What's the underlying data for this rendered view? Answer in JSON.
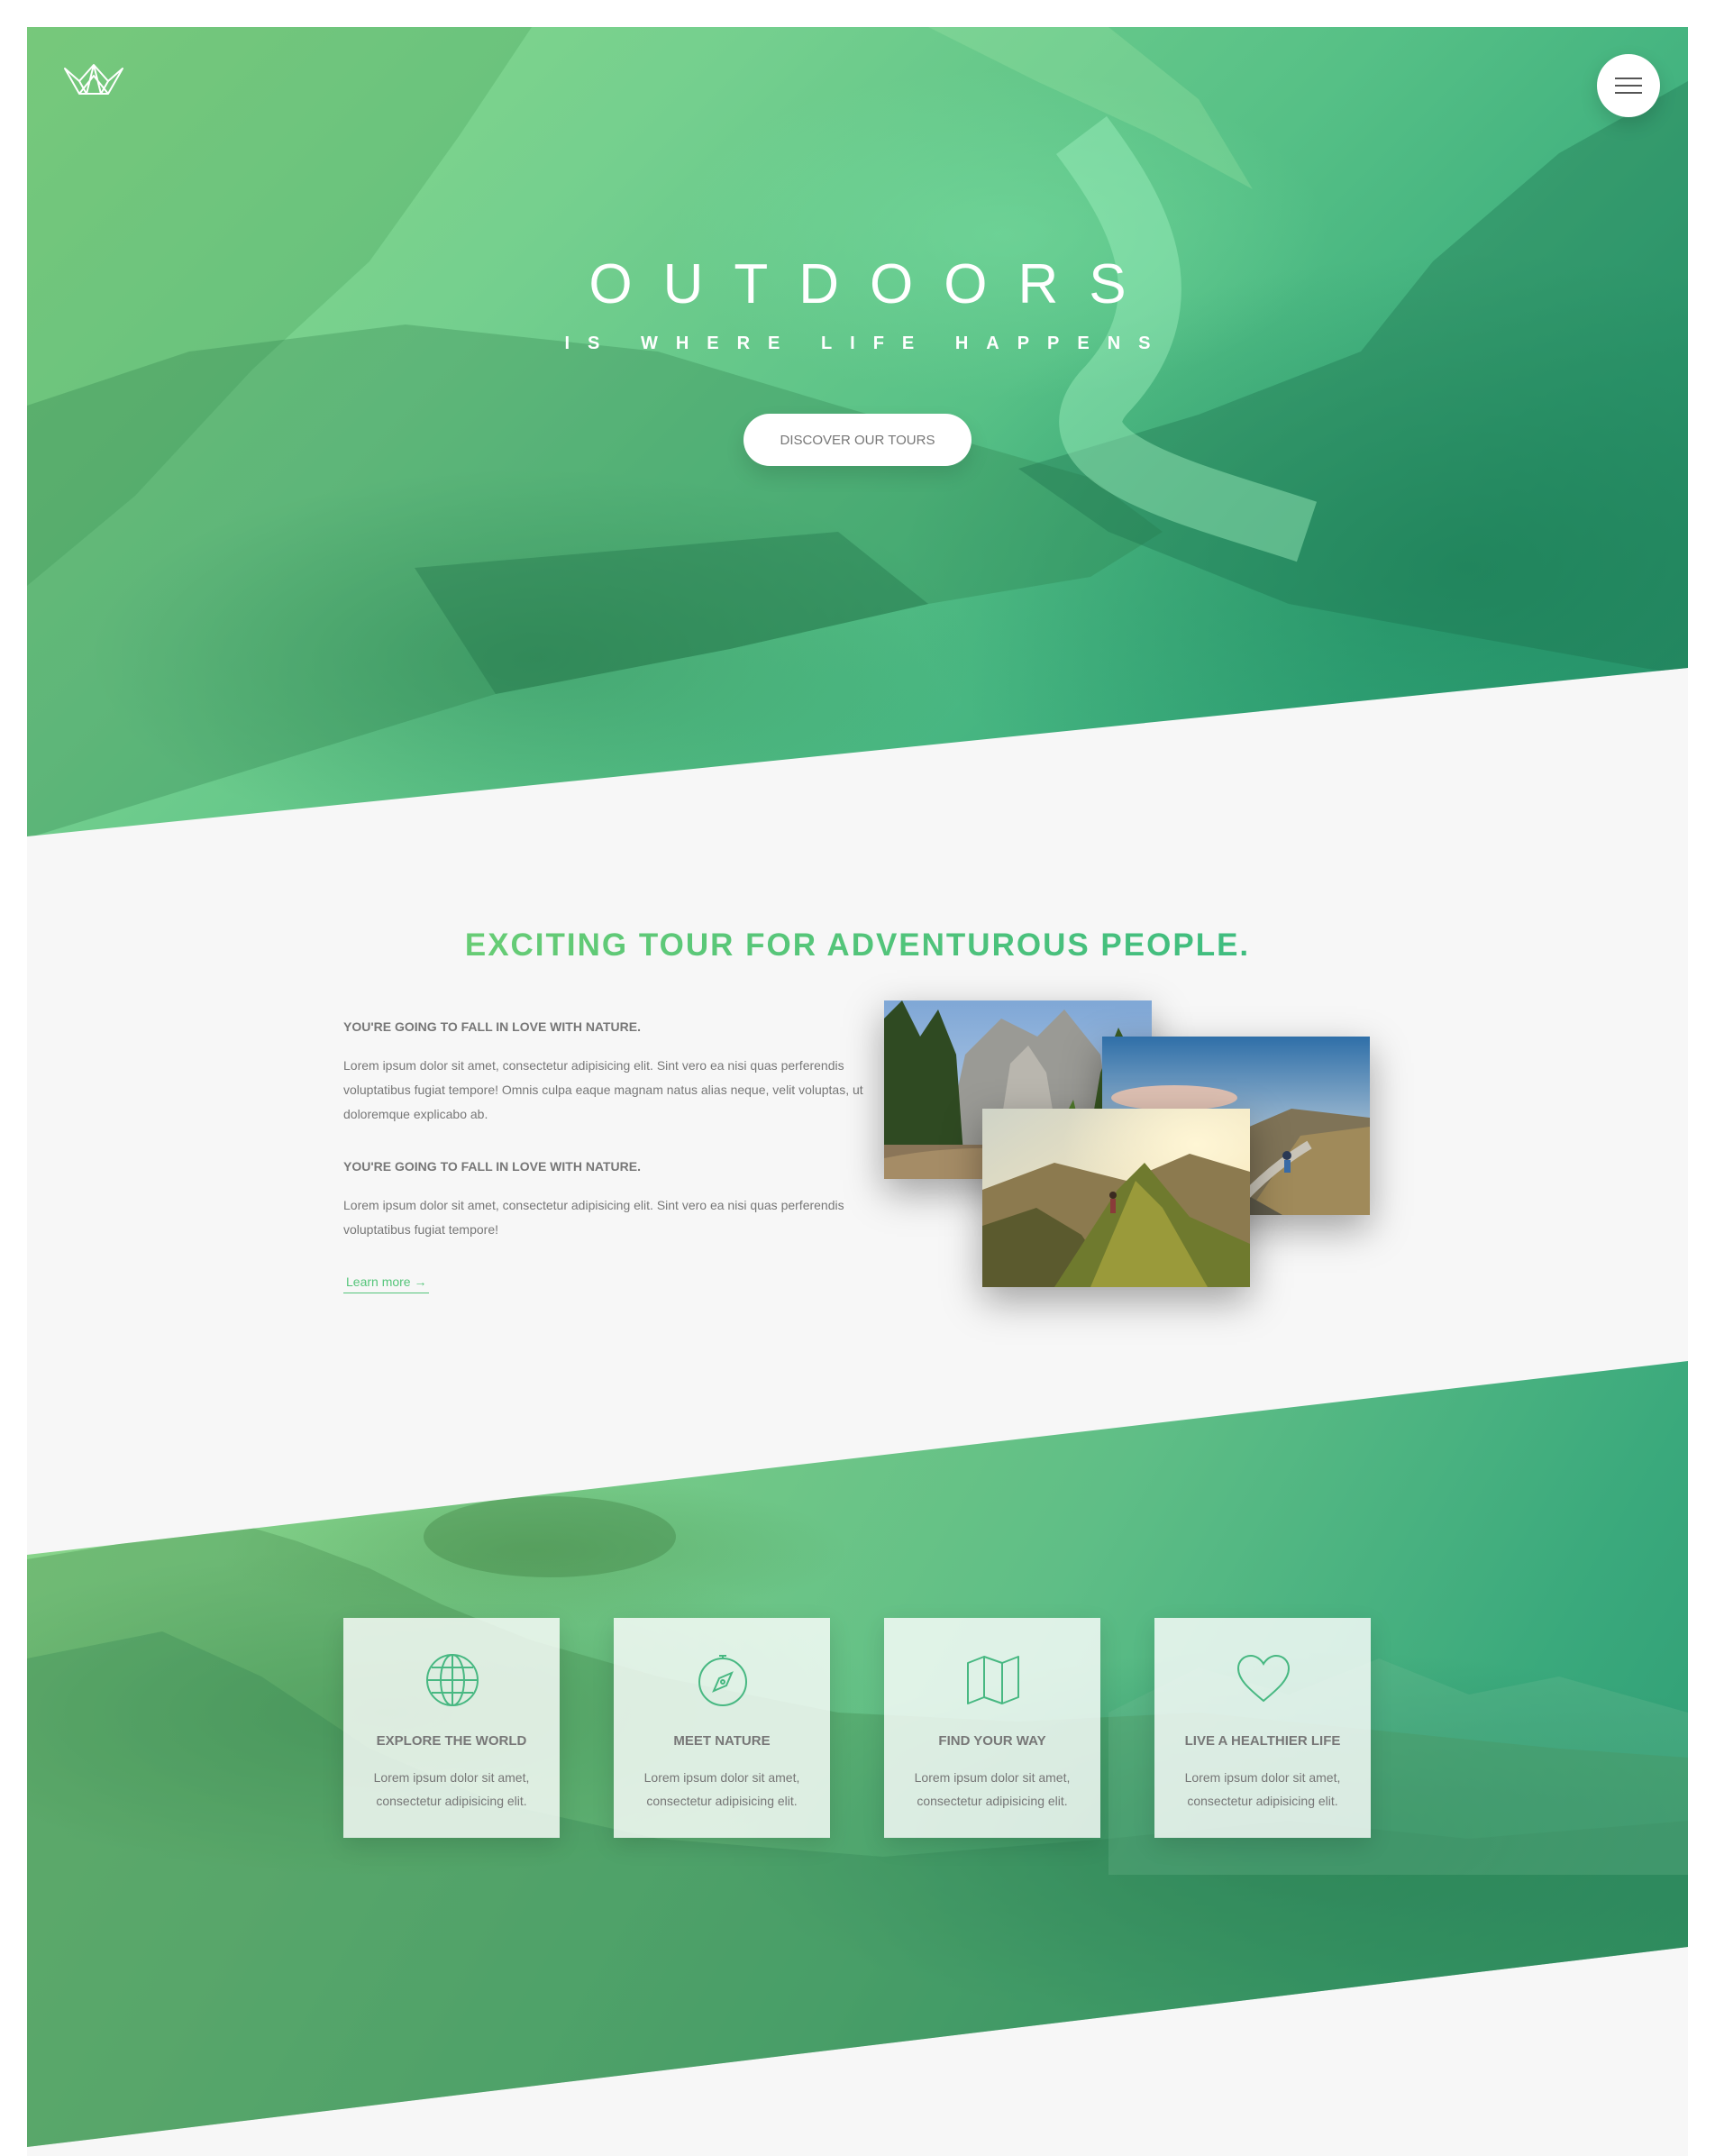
{
  "brand": {
    "logo_icon": "crown-icon"
  },
  "nav": {
    "menu_icon": "hamburger-menu-icon"
  },
  "hero": {
    "title": "OUTDOORS",
    "subtitle": "IS WHERE LIFE HAPPENS",
    "cta_label": "DISCOVER OUR TOURS"
  },
  "about": {
    "heading": "EXCITING TOUR FOR ADVENTUROUS PEOPLE.",
    "blocks": [
      {
        "title": "YOU'RE GOING TO FALL IN LOVE WITH NATURE.",
        "text": "Lorem ipsum dolor sit amet, consectetur adipisicing elit. Sint vero ea nisi quas perferendis voluptatibus fugiat tempore! Omnis culpa eaque magnam natus alias neque, velit voluptas, ut doloremque explicabo ab."
      },
      {
        "title": "YOU'RE GOING TO FALL IN LOVE WITH NATURE.",
        "text": "Lorem ipsum dolor sit amet, consectetur adipisicing elit. Sint vero ea nisi quas perferendis voluptatibus fugiat tempore!"
      }
    ],
    "link_label": "Learn more →"
  },
  "features": [
    {
      "icon": "globe-icon",
      "title": "EXPLORE THE WORLD",
      "text": "Lorem ipsum dolor sit amet, consectetur adipisicing elit."
    },
    {
      "icon": "compass-icon",
      "title": "MEET NATURE",
      "text": "Lorem ipsum dolor sit amet, consectetur adipisicing elit."
    },
    {
      "icon": "map-icon",
      "title": "FIND YOUR WAY",
      "text": "Lorem ipsum dolor sit amet, consectetur adipisicing elit."
    },
    {
      "icon": "heart-icon",
      "title": "LIVE A HEALTHIER LIFE",
      "text": "Lorem ipsum dolor sit amet, consectetur adipisicing elit."
    }
  ],
  "colors": {
    "primary_light": "#7ed56f",
    "primary_dark": "#28b485",
    "text_grey": "#777777",
    "background": "#f7f7f7"
  }
}
